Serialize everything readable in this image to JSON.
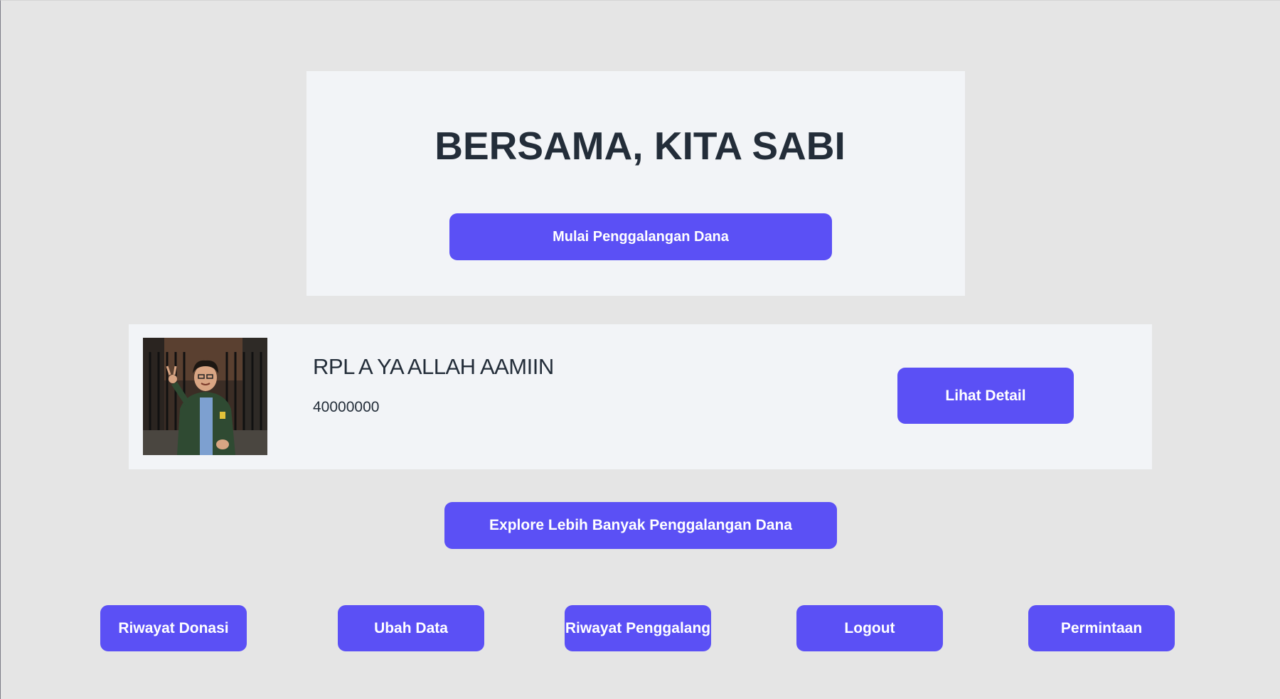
{
  "hero": {
    "title": "BERSAMA, KITA SABI",
    "start_button_label": "Mulai Penggalangan Dana"
  },
  "campaign": {
    "name": "RPL A YA ALLAH AAMIIN",
    "target": "40000000",
    "detail_button_label": "Lihat Detail"
  },
  "explore_button_label": "Explore Lebih Banyak Penggalangan Dana",
  "nav": {
    "donation_history": "Riwayat Donasi",
    "edit_data": "Ubah Data",
    "fundraiser_history": "Riwayat Penggalang",
    "logout": "Logout",
    "requests": "Permintaan"
  },
  "colors": {
    "background": "#e5e5e5",
    "panel": "#f2f4f7",
    "button": "#5b50f5",
    "text": "#232d39"
  }
}
